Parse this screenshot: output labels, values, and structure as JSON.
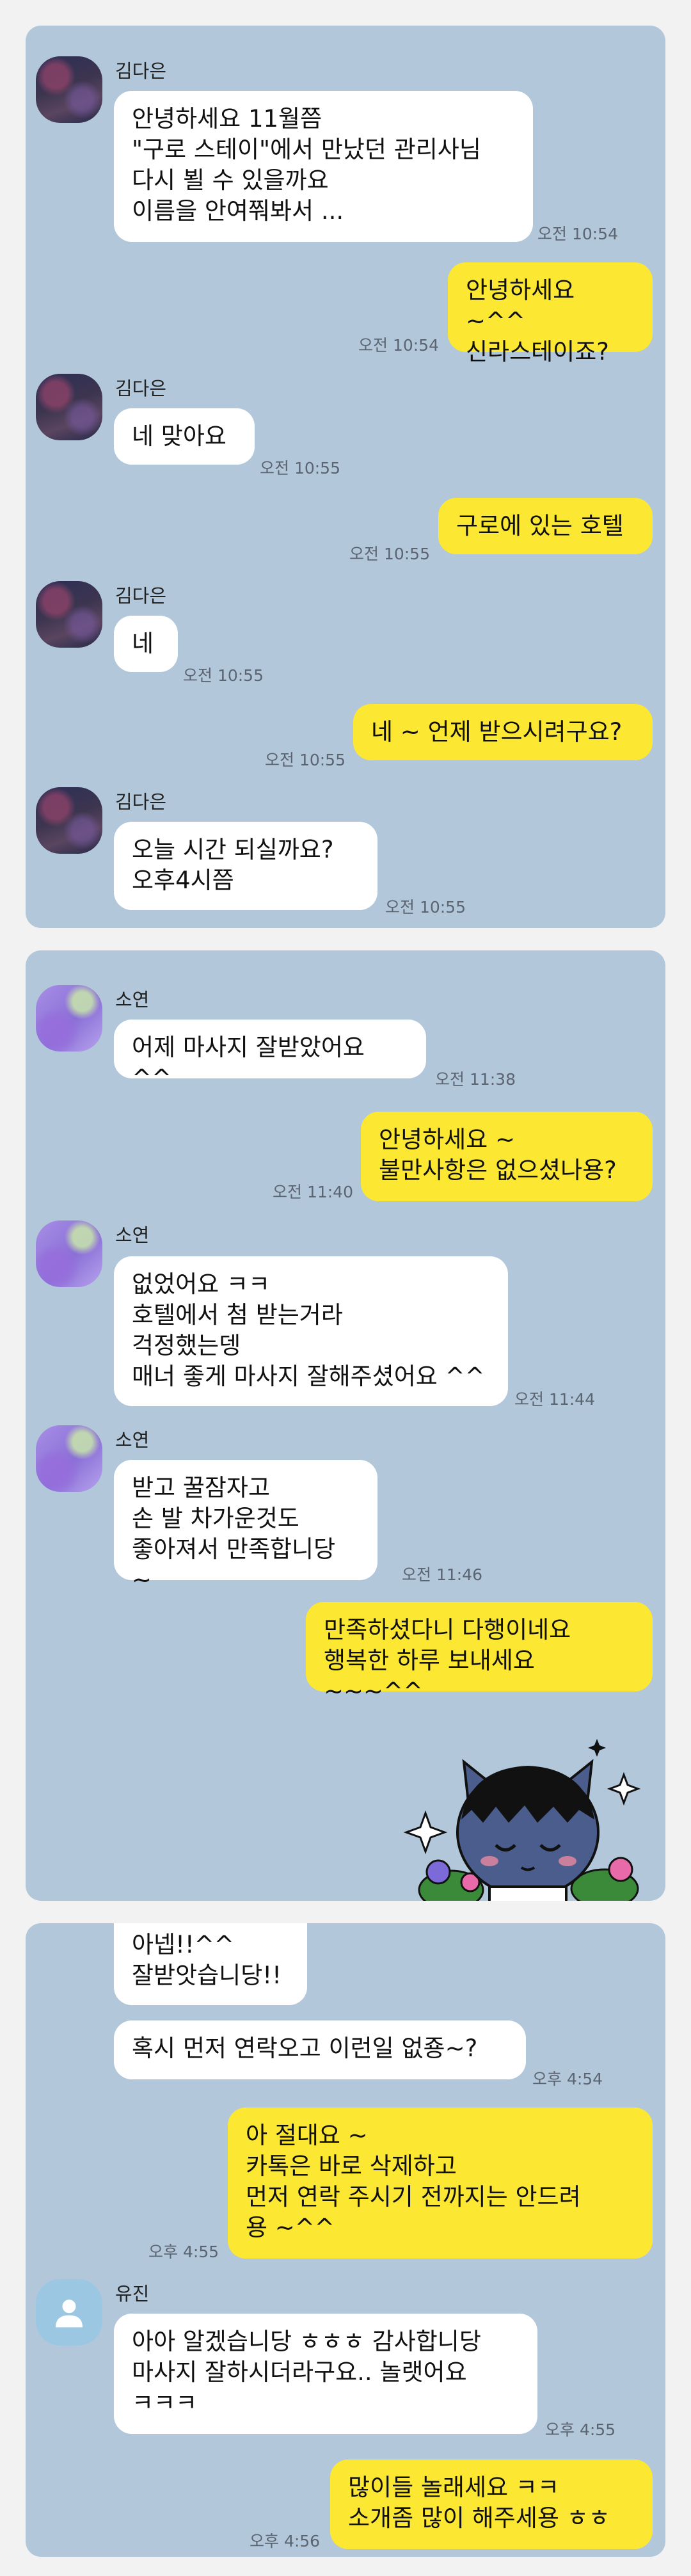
{
  "panel1": {
    "sender_name": "김다은",
    "m1_text": "안녕하세요 11월쯤\n\"구로 스테이\"에서 만났던 관리사님\n다시 뵐 수 있을까요\n이름을 안여쭤봐서 ...",
    "m1_time": "오전 10:54",
    "m2_text": "안녕하세요 ~^^\n신라스테이죠?",
    "m2_time": "오전 10:54",
    "m3_text": "네 맞아요",
    "m3_time": "오전 10:55",
    "m4_text": "구로에 있는 호텔",
    "m4_time": "오전 10:55",
    "m5_text": "네",
    "m5_time": "오전 10:55",
    "m6_text": "네 ~ 언제 받으시려구요?",
    "m6_time": "오전 10:55",
    "m7_text": "오늘  시간 되실까요?\n오후4시쯤",
    "m7_time": "오전 10:55"
  },
  "panel2": {
    "sender_name": "소연",
    "m1_text": "어제 마사지 잘받았어요 ^^",
    "m1_time": "오전 11:38",
    "m2_text": "안녕하세요 ~\n불만사항은 없으셨나용?",
    "m2_time": "오전 11:40",
    "m3_text": "없었어요 ㅋㅋ\n호텔에서 첨 받는거라\n걱정했는뎅\n매너 좋게 마사지 잘해주셨어요 ^^",
    "m3_time": "오전 11:44",
    "m4_text": "받고 꿀잠자고\n손 발 차가운것도\n좋아져서 만족합니당 ~",
    "m4_time": "오전 11:46",
    "m5_text": "만족하셨다니 다행이네요\n행복한 하루 보내세요 ~~~^^",
    "sticker_icon": "sleeping-cat-character-sticker"
  },
  "panel3": {
    "m1_text": "아넵!!^^\n잘받앗습니당!!",
    "m2_text": "혹시 먼저 연락오고 이런일 없죵~?",
    "m2_time": "오후 4:54",
    "m3_text": "아 절대요 ~\n카톡은 바로 삭제하고\n먼저 연락 주시기 전까지는 안드려\n용 ~^^",
    "m3_time": "오후 4:55",
    "sender_name": "유진",
    "m4_text": "아아 알겠습니당 ㅎㅎㅎ 감사합니당\n마사지 잘하시더라구요.. 놀랫어요\nㅋㅋㅋ",
    "m4_time": "오후 4:55",
    "m5_text": "많이들 놀래세요 ㅋㅋ\n소개좀 많이 해주세용 ㅎㅎ",
    "m5_time": "오후 4:56"
  },
  "colors": {
    "chat_background": "#b2c7da",
    "incoming_bubble": "#ffffff",
    "outgoing_bubble": "#fce832",
    "page_background": "#f2f2f2"
  }
}
